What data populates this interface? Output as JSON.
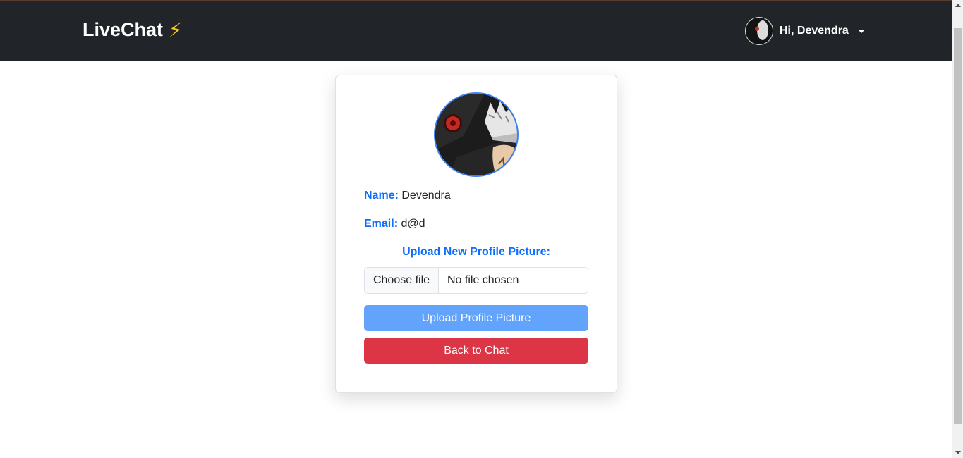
{
  "navbar": {
    "brand": "LiveChat",
    "brand_icon": "⚡",
    "greeting": "Hi, Devendra"
  },
  "profile": {
    "name_label": "Name:",
    "name_value": "Devendra",
    "email_label": "Email:",
    "email_value": "d@d",
    "upload_title": "Upload New Profile Picture:",
    "choose_file_label": "Choose file",
    "file_status": "No file chosen",
    "upload_button": "Upload Profile Picture",
    "back_button": "Back to Chat"
  },
  "colors": {
    "navbar_bg": "#212529",
    "accent_blue": "#0d6efd",
    "upload_button_bg": "#62a3fb",
    "back_button_bg": "#dc3545"
  }
}
